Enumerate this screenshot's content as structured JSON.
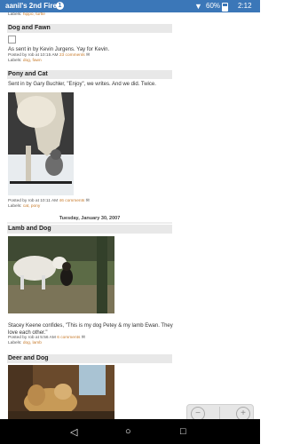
{
  "status": {
    "device": "aanil's 2nd Fire",
    "badge": "1",
    "battery": "60%",
    "time": "2:12"
  },
  "posts": [
    {
      "labels_prefix": "Labels:",
      "labels": "hippo, turtle"
    },
    {
      "title": "Dog and Fawn",
      "body": "As sent in by Kevin Jurgens. Yay for Kevin.",
      "posted": "Posted by rob at 10:15 AM",
      "comments": "23 comments",
      "labels_prefix": "Labels:",
      "labels": "dog, fawn"
    },
    {
      "title": "Pony and Cat",
      "body": "Sent in by Gary Buchler, \"Enjoy\", we writes. And we did. Twice.",
      "posted": "Posted by rob at 10:11 AM",
      "comments": "46 comments",
      "labels_prefix": "Labels:",
      "labels": "cat, pony"
    },
    {
      "date": "Tuesday, January 30, 2007",
      "title": "Lamb and Dog",
      "body": "Stacey Keene confides, \"This is my dog Petey & my lamb Ewan. They love each other.\"",
      "posted": "Posted by rob at 5:56 AM",
      "comments": "6 comments",
      "labels_prefix": "Labels:",
      "labels": "dog, lamb"
    },
    {
      "title": "Deer and Dog"
    }
  ],
  "nav": {
    "back": "◁",
    "home": "○",
    "recent": "□"
  }
}
